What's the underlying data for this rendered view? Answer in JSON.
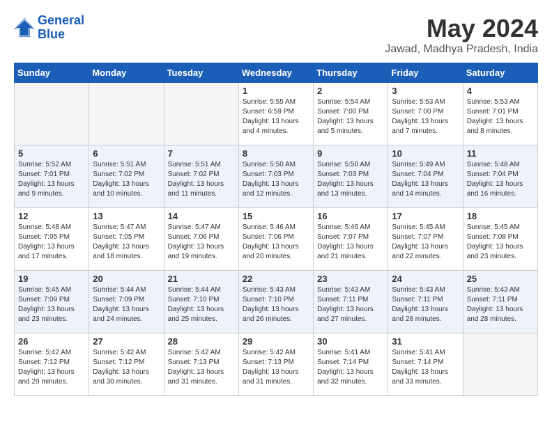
{
  "header": {
    "logo_line1": "General",
    "logo_line2": "Blue",
    "month_year": "May 2024",
    "location": "Jawad, Madhya Pradesh, India"
  },
  "weekdays": [
    "Sunday",
    "Monday",
    "Tuesday",
    "Wednesday",
    "Thursday",
    "Friday",
    "Saturday"
  ],
  "weeks": [
    [
      {
        "day": "",
        "sunrise": "",
        "sunset": "",
        "daylight": ""
      },
      {
        "day": "",
        "sunrise": "",
        "sunset": "",
        "daylight": ""
      },
      {
        "day": "",
        "sunrise": "",
        "sunset": "",
        "daylight": ""
      },
      {
        "day": "1",
        "sunrise": "Sunrise: 5:55 AM",
        "sunset": "Sunset: 6:59 PM",
        "daylight": "Daylight: 13 hours and 4 minutes."
      },
      {
        "day": "2",
        "sunrise": "Sunrise: 5:54 AM",
        "sunset": "Sunset: 7:00 PM",
        "daylight": "Daylight: 13 hours and 5 minutes."
      },
      {
        "day": "3",
        "sunrise": "Sunrise: 5:53 AM",
        "sunset": "Sunset: 7:00 PM",
        "daylight": "Daylight: 13 hours and 7 minutes."
      },
      {
        "day": "4",
        "sunrise": "Sunrise: 5:53 AM",
        "sunset": "Sunset: 7:01 PM",
        "daylight": "Daylight: 13 hours and 8 minutes."
      }
    ],
    [
      {
        "day": "5",
        "sunrise": "Sunrise: 5:52 AM",
        "sunset": "Sunset: 7:01 PM",
        "daylight": "Daylight: 13 hours and 9 minutes."
      },
      {
        "day": "6",
        "sunrise": "Sunrise: 5:51 AM",
        "sunset": "Sunset: 7:02 PM",
        "daylight": "Daylight: 13 hours and 10 minutes."
      },
      {
        "day": "7",
        "sunrise": "Sunrise: 5:51 AM",
        "sunset": "Sunset: 7:02 PM",
        "daylight": "Daylight: 13 hours and 11 minutes."
      },
      {
        "day": "8",
        "sunrise": "Sunrise: 5:50 AM",
        "sunset": "Sunset: 7:03 PM",
        "daylight": "Daylight: 13 hours and 12 minutes."
      },
      {
        "day": "9",
        "sunrise": "Sunrise: 5:50 AM",
        "sunset": "Sunset: 7:03 PM",
        "daylight": "Daylight: 13 hours and 13 minutes."
      },
      {
        "day": "10",
        "sunrise": "Sunrise: 5:49 AM",
        "sunset": "Sunset: 7:04 PM",
        "daylight": "Daylight: 13 hours and 14 minutes."
      },
      {
        "day": "11",
        "sunrise": "Sunrise: 5:48 AM",
        "sunset": "Sunset: 7:04 PM",
        "daylight": "Daylight: 13 hours and 16 minutes."
      }
    ],
    [
      {
        "day": "12",
        "sunrise": "Sunrise: 5:48 AM",
        "sunset": "Sunset: 7:05 PM",
        "daylight": "Daylight: 13 hours and 17 minutes."
      },
      {
        "day": "13",
        "sunrise": "Sunrise: 5:47 AM",
        "sunset": "Sunset: 7:05 PM",
        "daylight": "Daylight: 13 hours and 18 minutes."
      },
      {
        "day": "14",
        "sunrise": "Sunrise: 5:47 AM",
        "sunset": "Sunset: 7:06 PM",
        "daylight": "Daylight: 13 hours and 19 minutes."
      },
      {
        "day": "15",
        "sunrise": "Sunrise: 5:46 AM",
        "sunset": "Sunset: 7:06 PM",
        "daylight": "Daylight: 13 hours and 20 minutes."
      },
      {
        "day": "16",
        "sunrise": "Sunrise: 5:46 AM",
        "sunset": "Sunset: 7:07 PM",
        "daylight": "Daylight: 13 hours and 21 minutes."
      },
      {
        "day": "17",
        "sunrise": "Sunrise: 5:45 AM",
        "sunset": "Sunset: 7:07 PM",
        "daylight": "Daylight: 13 hours and 22 minutes."
      },
      {
        "day": "18",
        "sunrise": "Sunrise: 5:45 AM",
        "sunset": "Sunset: 7:08 PM",
        "daylight": "Daylight: 13 hours and 23 minutes."
      }
    ],
    [
      {
        "day": "19",
        "sunrise": "Sunrise: 5:45 AM",
        "sunset": "Sunset: 7:09 PM",
        "daylight": "Daylight: 13 hours and 23 minutes."
      },
      {
        "day": "20",
        "sunrise": "Sunrise: 5:44 AM",
        "sunset": "Sunset: 7:09 PM",
        "daylight": "Daylight: 13 hours and 24 minutes."
      },
      {
        "day": "21",
        "sunrise": "Sunrise: 5:44 AM",
        "sunset": "Sunset: 7:10 PM",
        "daylight": "Daylight: 13 hours and 25 minutes."
      },
      {
        "day": "22",
        "sunrise": "Sunrise: 5:43 AM",
        "sunset": "Sunset: 7:10 PM",
        "daylight": "Daylight: 13 hours and 26 minutes."
      },
      {
        "day": "23",
        "sunrise": "Sunrise: 5:43 AM",
        "sunset": "Sunset: 7:11 PM",
        "daylight": "Daylight: 13 hours and 27 minutes."
      },
      {
        "day": "24",
        "sunrise": "Sunrise: 5:43 AM",
        "sunset": "Sunset: 7:11 PM",
        "daylight": "Daylight: 13 hours and 28 minutes."
      },
      {
        "day": "25",
        "sunrise": "Sunrise: 5:43 AM",
        "sunset": "Sunset: 7:11 PM",
        "daylight": "Daylight: 13 hours and 28 minutes."
      }
    ],
    [
      {
        "day": "26",
        "sunrise": "Sunrise: 5:42 AM",
        "sunset": "Sunset: 7:12 PM",
        "daylight": "Daylight: 13 hours and 29 minutes."
      },
      {
        "day": "27",
        "sunrise": "Sunrise: 5:42 AM",
        "sunset": "Sunset: 7:12 PM",
        "daylight": "Daylight: 13 hours and 30 minutes."
      },
      {
        "day": "28",
        "sunrise": "Sunrise: 5:42 AM",
        "sunset": "Sunset: 7:13 PM",
        "daylight": "Daylight: 13 hours and 31 minutes."
      },
      {
        "day": "29",
        "sunrise": "Sunrise: 5:42 AM",
        "sunset": "Sunset: 7:13 PM",
        "daylight": "Daylight: 13 hours and 31 minutes."
      },
      {
        "day": "30",
        "sunrise": "Sunrise: 5:41 AM",
        "sunset": "Sunset: 7:14 PM",
        "daylight": "Daylight: 13 hours and 32 minutes."
      },
      {
        "day": "31",
        "sunrise": "Sunrise: 5:41 AM",
        "sunset": "Sunset: 7:14 PM",
        "daylight": "Daylight: 13 hours and 33 minutes."
      },
      {
        "day": "",
        "sunrise": "",
        "sunset": "",
        "daylight": ""
      }
    ]
  ]
}
